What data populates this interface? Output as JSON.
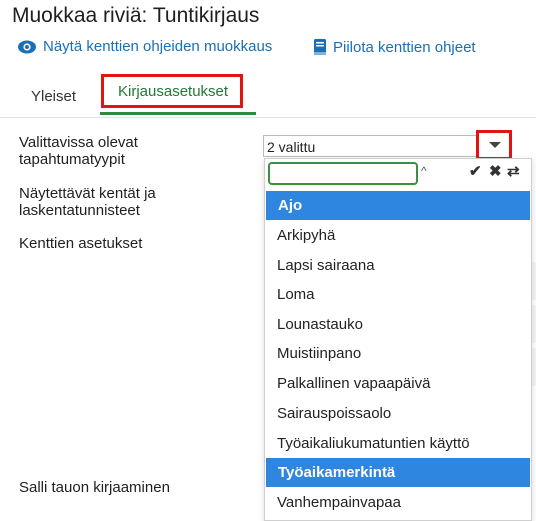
{
  "header": {
    "title": "Muokkaa riviä: Tuntikirjaus"
  },
  "links": {
    "show_help": {
      "label": "Näytä kenttien ohjeiden muokkaus",
      "icon": "eye-icon"
    },
    "hide_help": {
      "label": "Piilota kenttien ohjeet",
      "icon": "book-icon"
    }
  },
  "tabs": [
    {
      "label": "Yleiset"
    },
    {
      "label": "Kirjausasetukset",
      "active": true
    }
  ],
  "form": {
    "event_types_label": "Valittavissa olevat tapahtumatyypit",
    "event_types_value": "2 valittu",
    "fields_label": "Näytettävät kentät ja laskentatunnisteet",
    "field_settings_label": "Kenttien asetukset",
    "allow_break_label": "Salli tauon kirjaaminen"
  },
  "dropdown": {
    "search_value": "",
    "controls": {
      "select_all": "✔",
      "clear": "✖",
      "invert": "⇄"
    },
    "options": [
      {
        "label": "Ajo",
        "selected": true
      },
      {
        "label": "Arkipyhä",
        "selected": false
      },
      {
        "label": "Lapsi sairaana",
        "selected": false
      },
      {
        "label": "Loma",
        "selected": false
      },
      {
        "label": "Lounastauko",
        "selected": false
      },
      {
        "label": "Muistiinpano",
        "selected": false
      },
      {
        "label": "Palkallinen vapaapäivä",
        "selected": false
      },
      {
        "label": "Sairauspoissaolo",
        "selected": false
      },
      {
        "label": "Työaikaliukumatuntien käyttö",
        "selected": false
      },
      {
        "label": "Työaikamerkintä",
        "selected": true
      },
      {
        "label": "Vanhempainvapaa",
        "selected": false
      }
    ]
  },
  "colors": {
    "link": "#1a6fb5",
    "active_tab": "#1f7a35",
    "highlight": "#e11414",
    "selected_option": "#2f86e0"
  }
}
